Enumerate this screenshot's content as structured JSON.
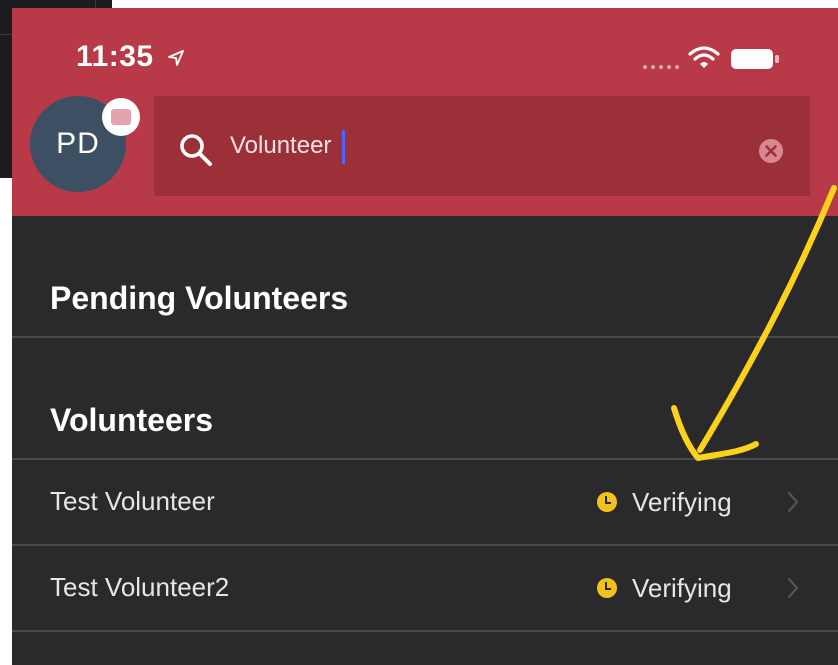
{
  "status_bar": {
    "time": "11:35"
  },
  "header": {
    "avatar_initials": "PD",
    "search": {
      "value": "Volunteer"
    }
  },
  "sections": [
    {
      "title": "Pending Volunteers"
    },
    {
      "title": "Volunteers"
    }
  ],
  "volunteers": [
    {
      "name": "Test Volunteer",
      "status": "Verifying"
    },
    {
      "name": "Test Volunteer2",
      "status": "Verifying"
    }
  ],
  "colors": {
    "header": "#b83a48",
    "search_bar": "#9c3039",
    "list_background": "#2a2a2c",
    "status_clock": "#f2c21a",
    "annotation_arrow": "#ffd21a"
  },
  "icons": {
    "location": "location-arrow-icon",
    "signal": "signal-dots-icon",
    "wifi": "wifi-icon",
    "battery": "battery-icon",
    "search": "search-icon",
    "clear": "clear-icon",
    "status": "clock-icon",
    "row_disclosure": "chevron-right-icon"
  }
}
